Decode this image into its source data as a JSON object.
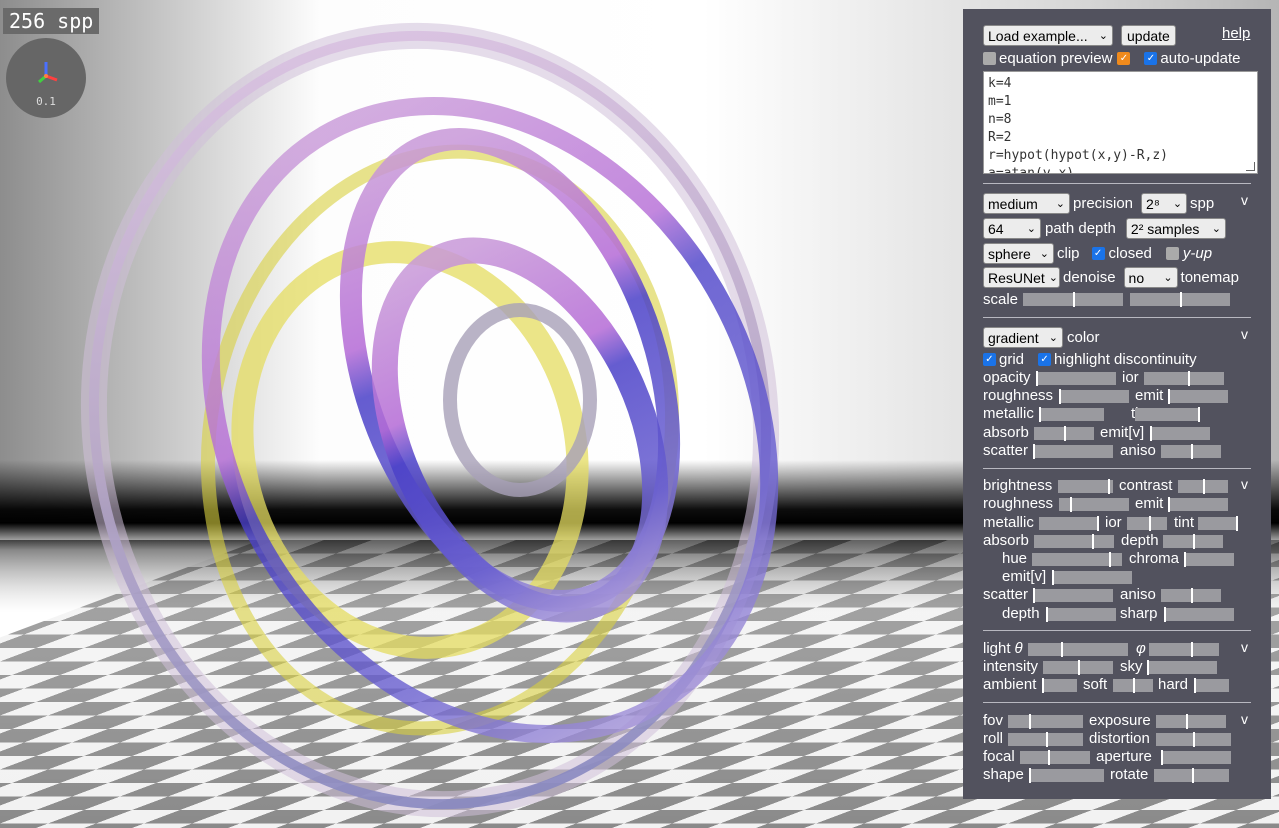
{
  "viewport": {
    "spp_counter": "256 spp",
    "axes_scale": "0.1"
  },
  "top": {
    "load_example": "Load example...",
    "update": "update",
    "help": "help",
    "equation_preview": "equation preview",
    "auto_update": "auto-update",
    "code_lines": [
      "k=4",
      "m=1",
      "n=8",
      "R=2",
      "r=hypot(hypot(x,y)-R,z)",
      "a=atan(y,x)"
    ]
  },
  "render": {
    "quality": "medium",
    "precision": "precision",
    "spp_select": "2⁸",
    "spp": "spp",
    "path_depth_select": "64",
    "path_depth": "path depth",
    "samples_select": "2² samples",
    "clip_select": "sphere",
    "clip": "clip",
    "closed": "closed",
    "y_up": "y-up",
    "denoise_select": "ResUNet",
    "denoise": "denoise",
    "tonemap_select": "no",
    "tonemap": "tonemap",
    "scale": "scale",
    "caret": "v"
  },
  "material": {
    "color_select": "gradient",
    "color": "color",
    "grid": "grid",
    "highlight": "highlight discontinuity",
    "opacity": "opacity",
    "ior": "ior",
    "roughness": "roughness",
    "emit": "emit",
    "metallic": "metallic",
    "tint": "tint",
    "absorb": "absorb",
    "emit_v": "emit[v]",
    "scatter": "scatter",
    "aniso": "aniso",
    "caret": "v"
  },
  "background": {
    "brightness": "brightness",
    "contrast": "contrast",
    "roughness": "roughness",
    "emit": "emit",
    "metallic": "metallic",
    "ior": "ior",
    "tint": "tint",
    "absorb": "absorb",
    "depth": "depth",
    "hue": "hue",
    "chroma": "chroma",
    "emit_v": "emit[v]",
    "scatter": "scatter",
    "aniso": "aniso",
    "depth2": "depth",
    "sharp": "sharp",
    "caret": "v"
  },
  "light": {
    "light": "light",
    "theta": "θ",
    "phi": "φ",
    "intensity": "intensity",
    "sky": "sky",
    "ambient": "ambient",
    "soft": "soft",
    "hard": "hard",
    "caret": "v"
  },
  "camera": {
    "fov": "fov",
    "exposure": "exposure",
    "roll": "roll",
    "distortion": "distortion",
    "focal": "focal",
    "aperture": "aperture",
    "shape": "shape",
    "rotate": "rotate",
    "caret": "v"
  },
  "sliders": {
    "scale_a": 0.5,
    "scale_b": 0.5,
    "opacity": 0.0,
    "ior": 0.55,
    "roughness": 0.0,
    "emit": 0.0,
    "metallic": 0.0,
    "tint": 0.97,
    "absorb": 0.5,
    "emit_v": 0.0,
    "scatter": 0.0,
    "aniso": 0.5,
    "bg_brightness": 0.9,
    "bg_contrast": 0.5,
    "bg_roughness": 0.15,
    "bg_emit": 0.0,
    "bg_metallic": 0.97,
    "bg_ior": 0.55,
    "bg_tint": 0.97,
    "bg_absorb": 0.72,
    "bg_depth": 0.5,
    "bg_hue": 0.85,
    "bg_chroma": 0.0,
    "bg_emit_v": 0.0,
    "bg_scatter": 0.0,
    "bg_aniso": 0.5,
    "bg_depth2": 0.0,
    "bg_sharp": 0.0,
    "light_theta": 0.33,
    "light_phi": 0.6,
    "intensity": 0.5,
    "sky": 0.0,
    "ambient": 0.0,
    "soft": 0.5,
    "hard": 0.0,
    "fov": 0.28,
    "exposure": 0.43,
    "roll": 0.5,
    "distortion": 0.49,
    "focal": 0.4,
    "aperture": 0.0,
    "shape": 0.0,
    "rotate": 0.5
  },
  "colors": {
    "panel": "#52525e",
    "checkbox_on": "#1a73e8",
    "checkbox_orange": "#f08a1c",
    "ring_purple": "#b46ad6",
    "ring_blue": "#4040c8",
    "ring_yellow": "#d8d040"
  }
}
